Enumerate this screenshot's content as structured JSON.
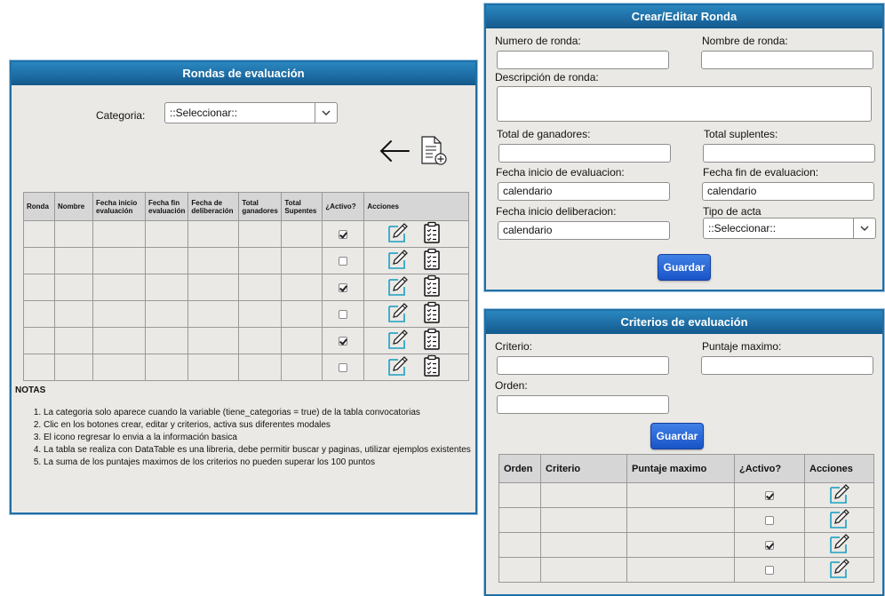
{
  "rondas_panel": {
    "title": "Rondas de evaluación",
    "categoria_label": "Categoria:",
    "categoria_value": "::Seleccionar::",
    "icons": [
      "back-arrow-icon",
      "new-document-icon"
    ],
    "table": {
      "headers": [
        "Ronda",
        "Nombre",
        "Fecha inicio evaluación",
        "Fecha fin evaluación",
        "Fecha de deliberación",
        "Total ganadores",
        "Total Supentes",
        "¿Activo?",
        "Acciones"
      ],
      "rows": [
        {
          "activo": true
        },
        {
          "activo": false
        },
        {
          "activo": true
        },
        {
          "activo": false
        },
        {
          "activo": true
        },
        {
          "activo": false
        }
      ]
    },
    "notes_title": "NOTAS",
    "notes": [
      "La categoria solo aparece cuando la variable (tiene_categorias = true) de la tabla convocatorias",
      "Clic en los botones crear, editar y criterios, activa sus diferentes modales",
      "El icono regresar lo envia a la información basica",
      "La tabla se realiza con DataTable es una libreria, debe permitir buscar y paginas, utilizar ejemplos existentes",
      "La suma de los puntajes maximos de los criterios no pueden superar los 100 puntos"
    ]
  },
  "crear_panel": {
    "title": "Crear/Editar Ronda",
    "numero_label": "Numero de ronda:",
    "nombre_label": "Nombre de ronda:",
    "descripcion_label": "Descripción de ronda:",
    "ganadores_label": "Total de ganadores:",
    "suplentes_label": "Total suplentes:",
    "fecha_inicio_eval_label": "Fecha inicio de evaluacion:",
    "fecha_inicio_eval_value": "calendario",
    "fecha_fin_eval_label": "Fecha fin de evaluacion:",
    "fecha_fin_eval_value": "calendario",
    "fecha_inicio_delib_label": "Fecha inicio deliberacion:",
    "fecha_inicio_delib_value": "calendario",
    "tipo_acta_label": "Tipo de acta",
    "tipo_acta_value": "::Seleccionar::",
    "save_label": "Guardar"
  },
  "criterios_panel": {
    "title": "Criterios de evaluación",
    "criterio_label": "Criterio:",
    "puntaje_label": "Puntaje maximo:",
    "orden_label": "Orden:",
    "save_label": "Guardar",
    "table": {
      "headers": [
        "Orden",
        "Criterio",
        "Puntaje maximo",
        "¿Activo?",
        "Acciones"
      ],
      "rows": [
        {
          "activo": true
        },
        {
          "activo": false
        },
        {
          "activo": true
        },
        {
          "activo": false
        }
      ]
    }
  },
  "colors": {
    "header_top": "#2a87c0",
    "header_bottom": "#14598d",
    "panel_bg": "#ebe9e5",
    "button": "#2a63d6",
    "edit_icon": "#1aa0c4"
  }
}
